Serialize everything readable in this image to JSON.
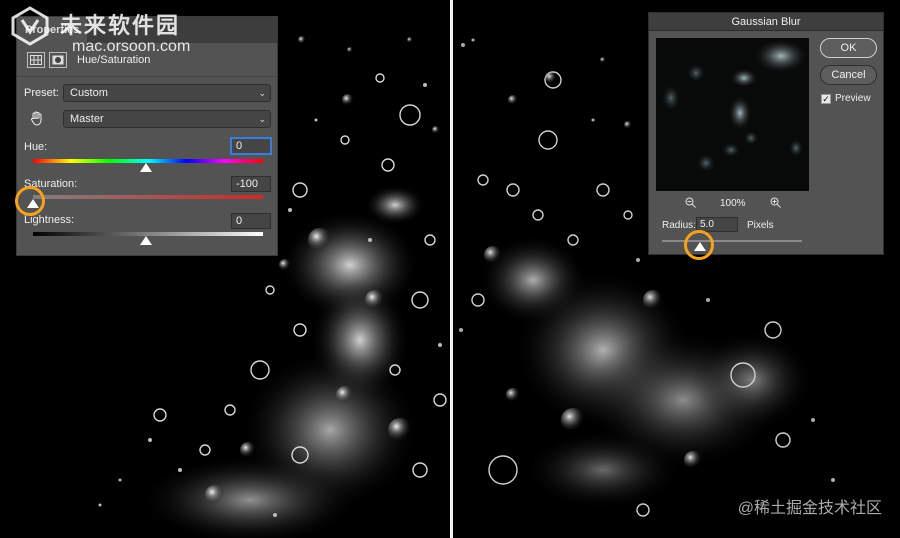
{
  "watermark": {
    "site_name": "未来软件园",
    "url": "mac.orsoon.com"
  },
  "properties_panel": {
    "tab_label": "Properties",
    "adjustment_icon": "hue-saturation-layer-icon",
    "mask_icon": "mask-icon",
    "title": "Hue/Saturation",
    "preset_label": "Preset:",
    "preset_value": "Custom",
    "channel_value": "Master",
    "hue_label": "Hue:",
    "hue_value": "0",
    "saturation_label": "Saturation:",
    "saturation_value": "-100",
    "lightness_label": "Lightness:",
    "lightness_value": "0"
  },
  "gaussian_blur": {
    "title": "Gaussian Blur",
    "ok_label": "OK",
    "cancel_label": "Cancel",
    "preview_label": "Preview",
    "preview_checked": true,
    "zoom_level": "100%",
    "radius_label": "Radius:",
    "radius_value": "5.0",
    "units": "Pixels"
  },
  "highlight_color": "#f7a21b",
  "credit": "@稀土掘金技术社区"
}
